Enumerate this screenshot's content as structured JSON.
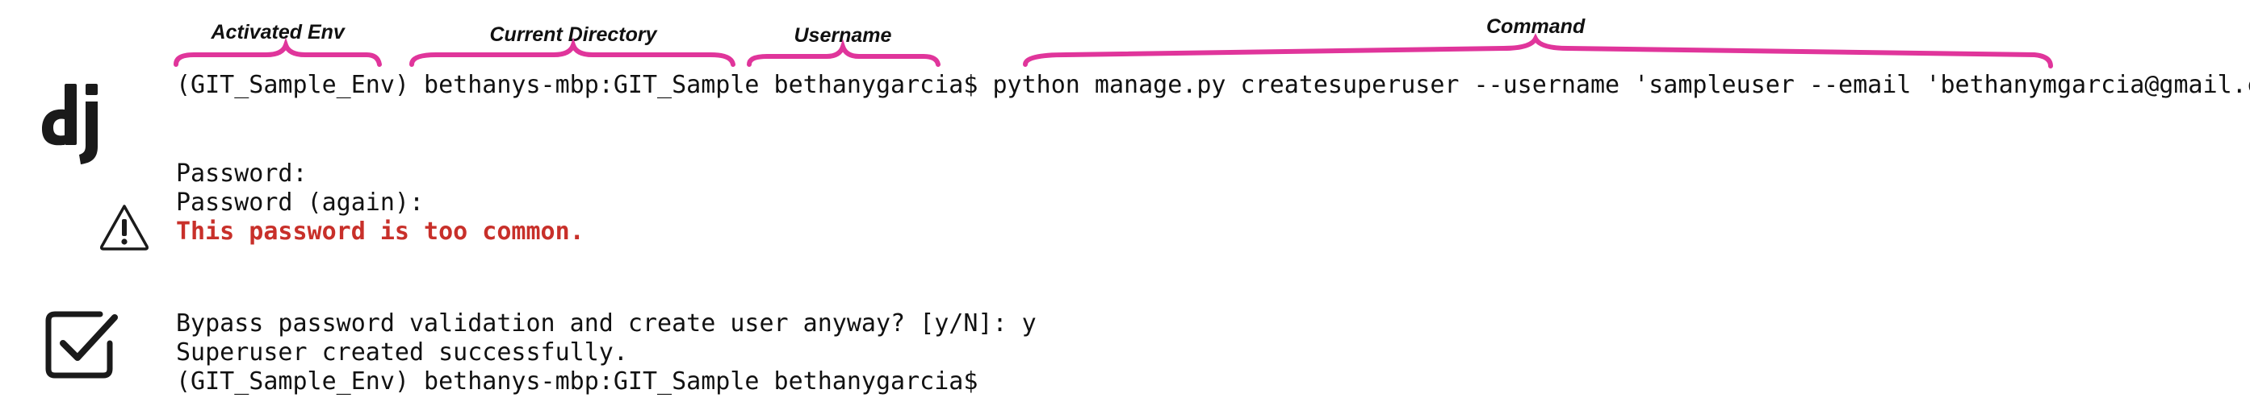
{
  "annotations": {
    "activated_env": "Activated Env",
    "current_directory": "Current Directory",
    "username": "Username",
    "command": "Command"
  },
  "terminal": {
    "prompt_env": "(GIT_Sample_Env)",
    "prompt_host_dir": "bethanys-mbp:GIT_Sample",
    "prompt_user": "bethanygarcia$",
    "command": "python manage.py createsuperuser --username 'sampleuser --email 'bethanymgarcia@gmail.com'",
    "password_line": "Password:",
    "password_again_line": "Password (again):",
    "error_line": "This password is too common.",
    "bypass_line": "Bypass password validation and create user anyway? [y/N]: y",
    "success_line": "Superuser created successfully.",
    "final_prompt": "(GIT_Sample_Env) bethanys-mbp:GIT_Sample bethanygarcia$"
  },
  "icons": {
    "logo": "django-logo",
    "warning": "warning-icon",
    "success": "checkbox-checked-icon"
  },
  "colors": {
    "brace": "#e0359b",
    "error": "#c8302a",
    "text": "#111111"
  }
}
